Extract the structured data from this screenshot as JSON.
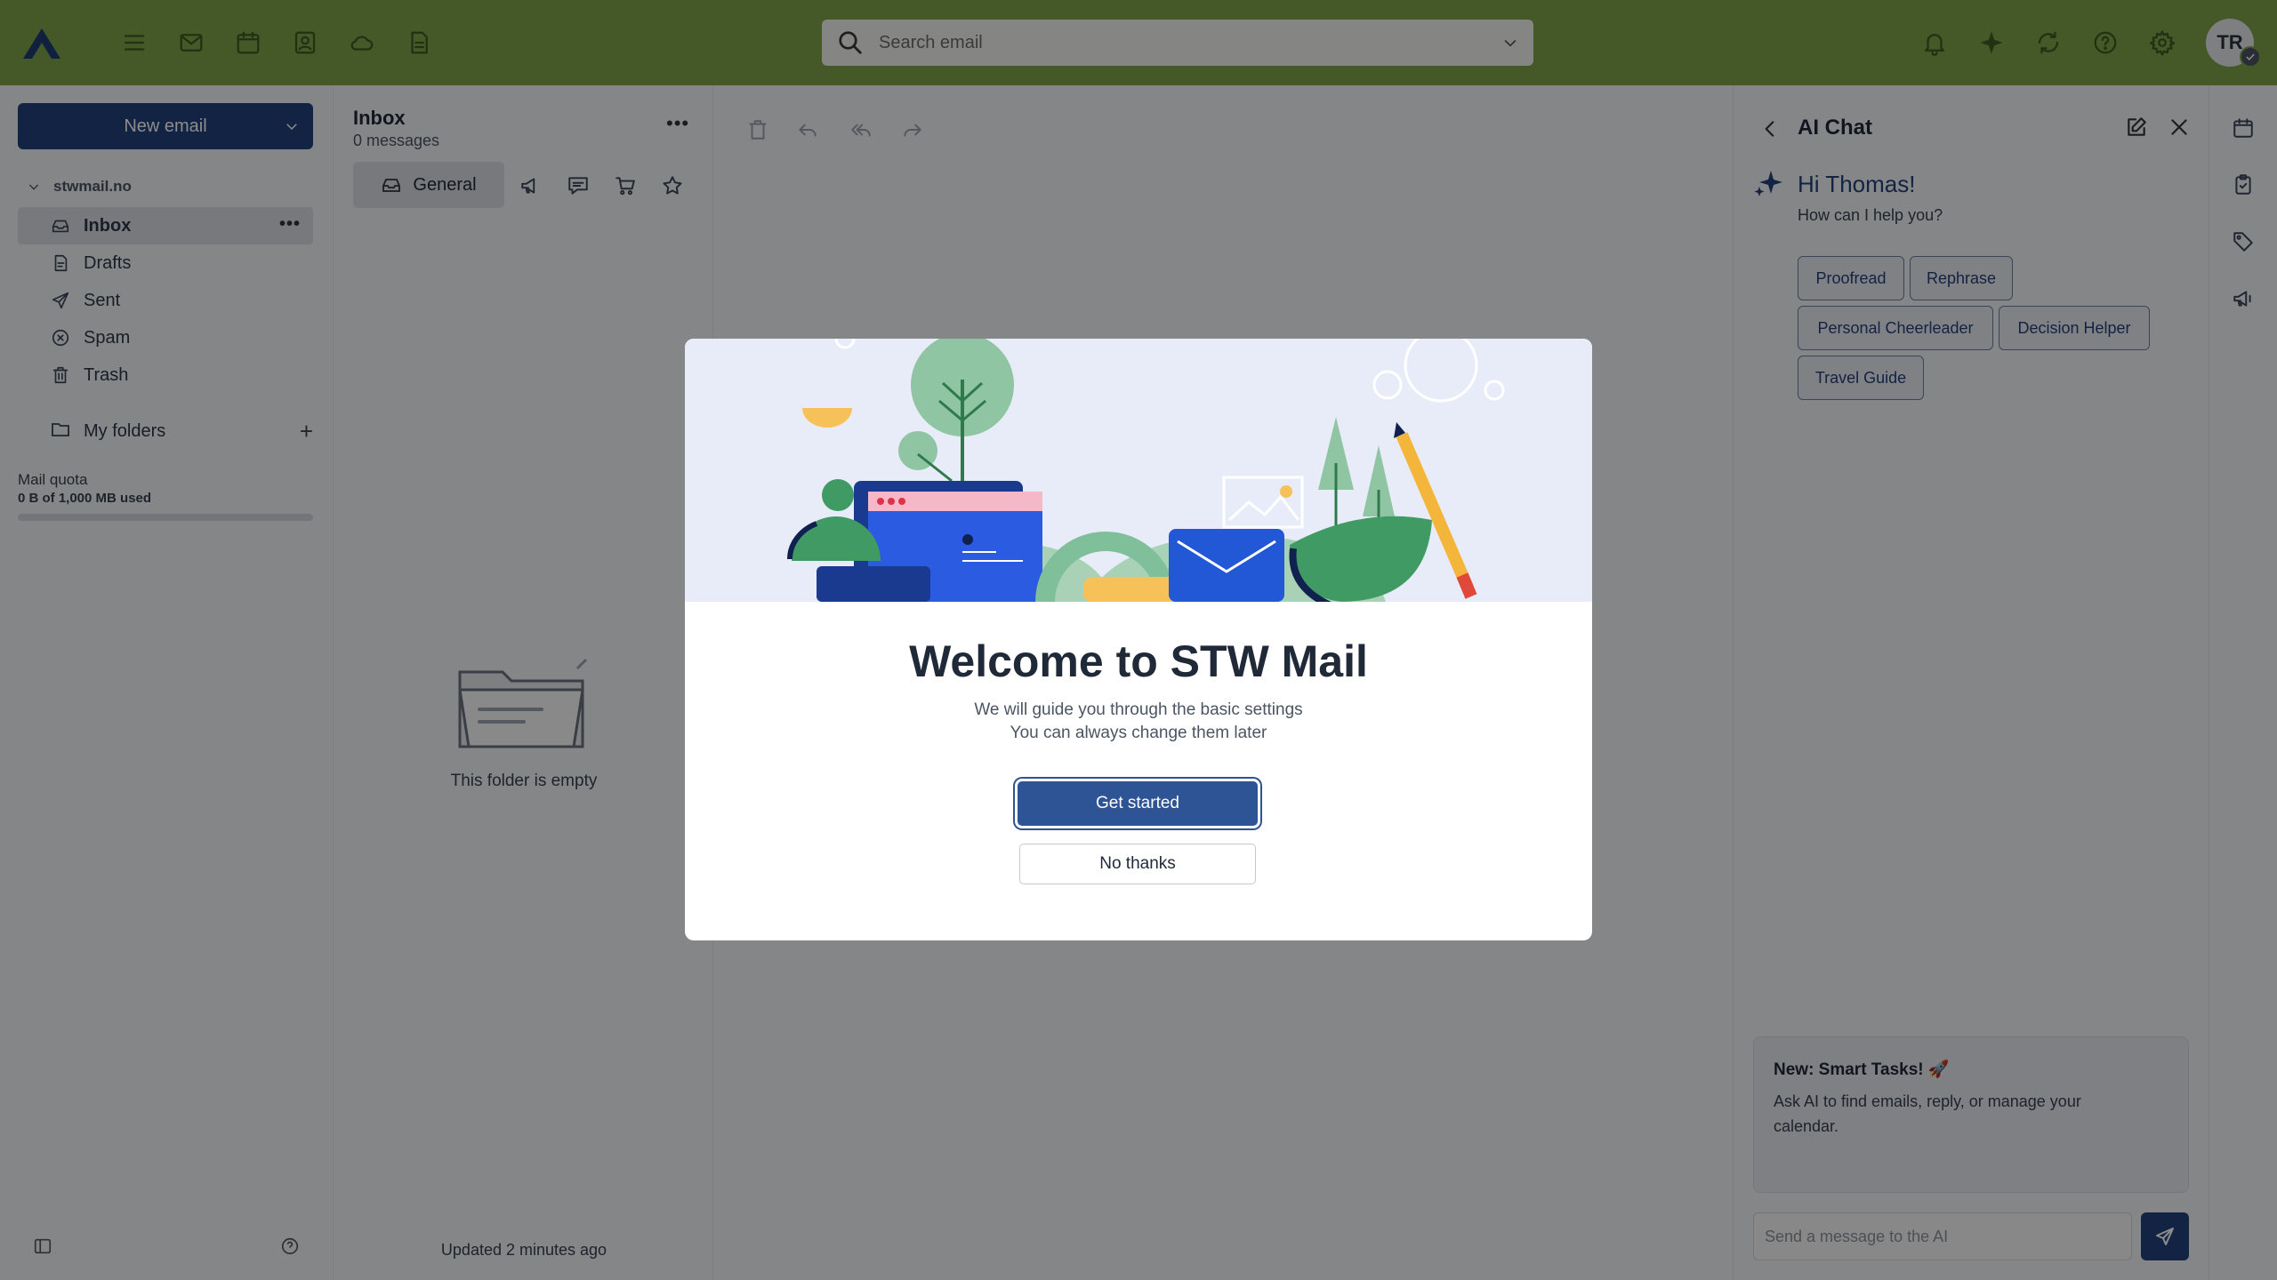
{
  "app": {
    "colors": {
      "topbar": "#7da04a",
      "primary": "#24407a",
      "accent_text": "#24407a"
    }
  },
  "topbar": {
    "nav_icons": [
      "menu-icon",
      "mail-icon",
      "calendar-icon",
      "contacts-icon",
      "cloud-icon",
      "document-icon"
    ],
    "search_placeholder": "Search email",
    "right_icons": [
      "bell-icon",
      "ai-sparkle-icon",
      "sync-icon",
      "help-icon",
      "settings-icon"
    ],
    "avatar_initials": "TR"
  },
  "sidebar": {
    "new_email_label": "New email",
    "account": "stwmail.no",
    "folders": [
      {
        "label": "Inbox",
        "icon": "inbox-icon",
        "active": true
      },
      {
        "label": "Drafts",
        "icon": "draft-icon",
        "active": false
      },
      {
        "label": "Sent",
        "icon": "send-icon",
        "active": false
      },
      {
        "label": "Spam",
        "icon": "spam-icon",
        "active": false
      },
      {
        "label": "Trash",
        "icon": "trash-icon",
        "active": false
      }
    ],
    "my_folders_label": "My folders",
    "quota_label": "Mail quota",
    "quota_value": "0 B of 1,000 MB used",
    "quota_fraction": 0.0
  },
  "message_list": {
    "title": "Inbox",
    "count": "0 messages",
    "category_general": "General",
    "category_icons": [
      "megaphone-icon",
      "chat-icon",
      "cart-icon",
      "star-icon"
    ],
    "empty_text": "This folder is empty",
    "updated_text": "Updated 2 minutes ago"
  },
  "ai_chat": {
    "title": "AI Chat",
    "greeting": "Hi Thomas!",
    "prompt": "How can I help you?",
    "chips": [
      "Proofread",
      "Rephrase",
      "Personal Cheerleader",
      "Decision Helper",
      "Travel Guide"
    ],
    "card_title": "New: Smart Tasks! 🚀",
    "card_text": "Ask AI to find emails, reply, or manage your calendar.",
    "input_placeholder": "Send a message to the AI"
  },
  "rail_icons": [
    "calendar-icon",
    "tasks-icon",
    "tag-icon",
    "megaphone-icon"
  ],
  "modal": {
    "title": "Welcome to STW Mail",
    "subtitle_line1": "We will guide you through the basic settings",
    "subtitle_line2": "You can always change them later",
    "primary_button": "Get started",
    "secondary_button": "No thanks"
  }
}
